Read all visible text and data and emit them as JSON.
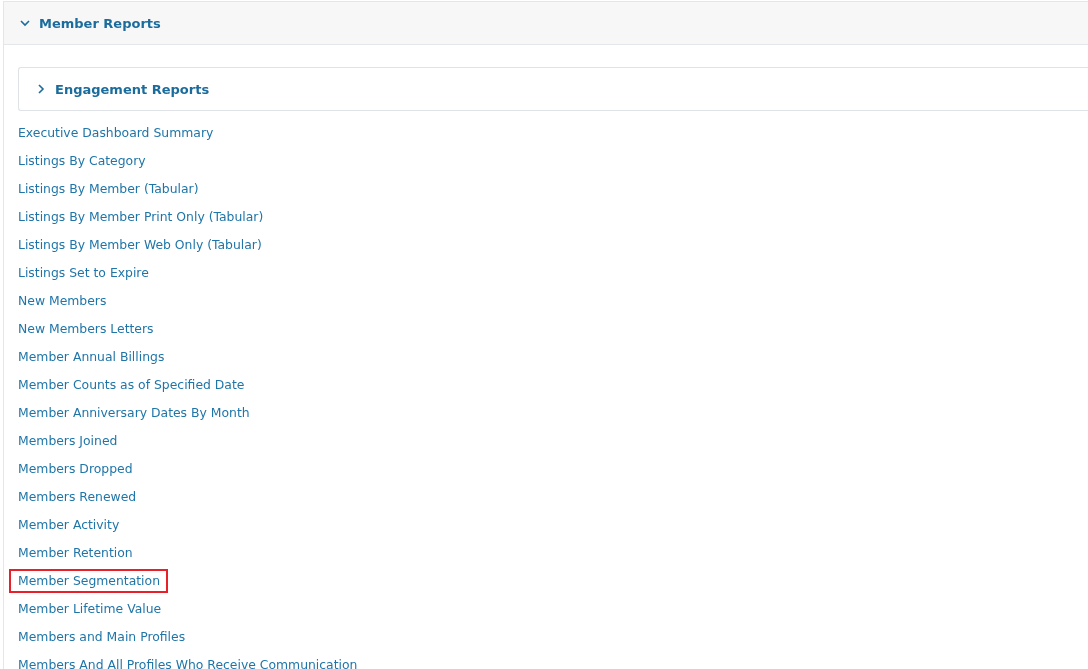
{
  "section": {
    "title": "Member Reports",
    "expanded": true
  },
  "subsection": {
    "title": "Engagement Reports",
    "expanded": false
  },
  "reports": [
    {
      "label": "Executive Dashboard Summary",
      "highlighted": false
    },
    {
      "label": "Listings By Category",
      "highlighted": false
    },
    {
      "label": "Listings By Member (Tabular)",
      "highlighted": false
    },
    {
      "label": "Listings By Member Print Only (Tabular)",
      "highlighted": false
    },
    {
      "label": "Listings By Member Web Only (Tabular)",
      "highlighted": false
    },
    {
      "label": "Listings Set to Expire",
      "highlighted": false
    },
    {
      "label": "New Members",
      "highlighted": false
    },
    {
      "label": "New Members Letters",
      "highlighted": false
    },
    {
      "label": "Member Annual Billings",
      "highlighted": false
    },
    {
      "label": "Member Counts as of Specified Date",
      "highlighted": false
    },
    {
      "label": "Member Anniversary Dates By Month",
      "highlighted": false
    },
    {
      "label": "Members Joined",
      "highlighted": false
    },
    {
      "label": "Members Dropped",
      "highlighted": false
    },
    {
      "label": "Members Renewed",
      "highlighted": false
    },
    {
      "label": "Member Activity",
      "highlighted": false
    },
    {
      "label": "Member Retention",
      "highlighted": false
    },
    {
      "label": "Member Segmentation",
      "highlighted": true
    },
    {
      "label": "Member Lifetime Value",
      "highlighted": false
    },
    {
      "label": "Members and Main Profiles",
      "highlighted": false
    },
    {
      "label": "Members And All Profiles Who Receive Communication",
      "highlighted": false
    }
  ]
}
